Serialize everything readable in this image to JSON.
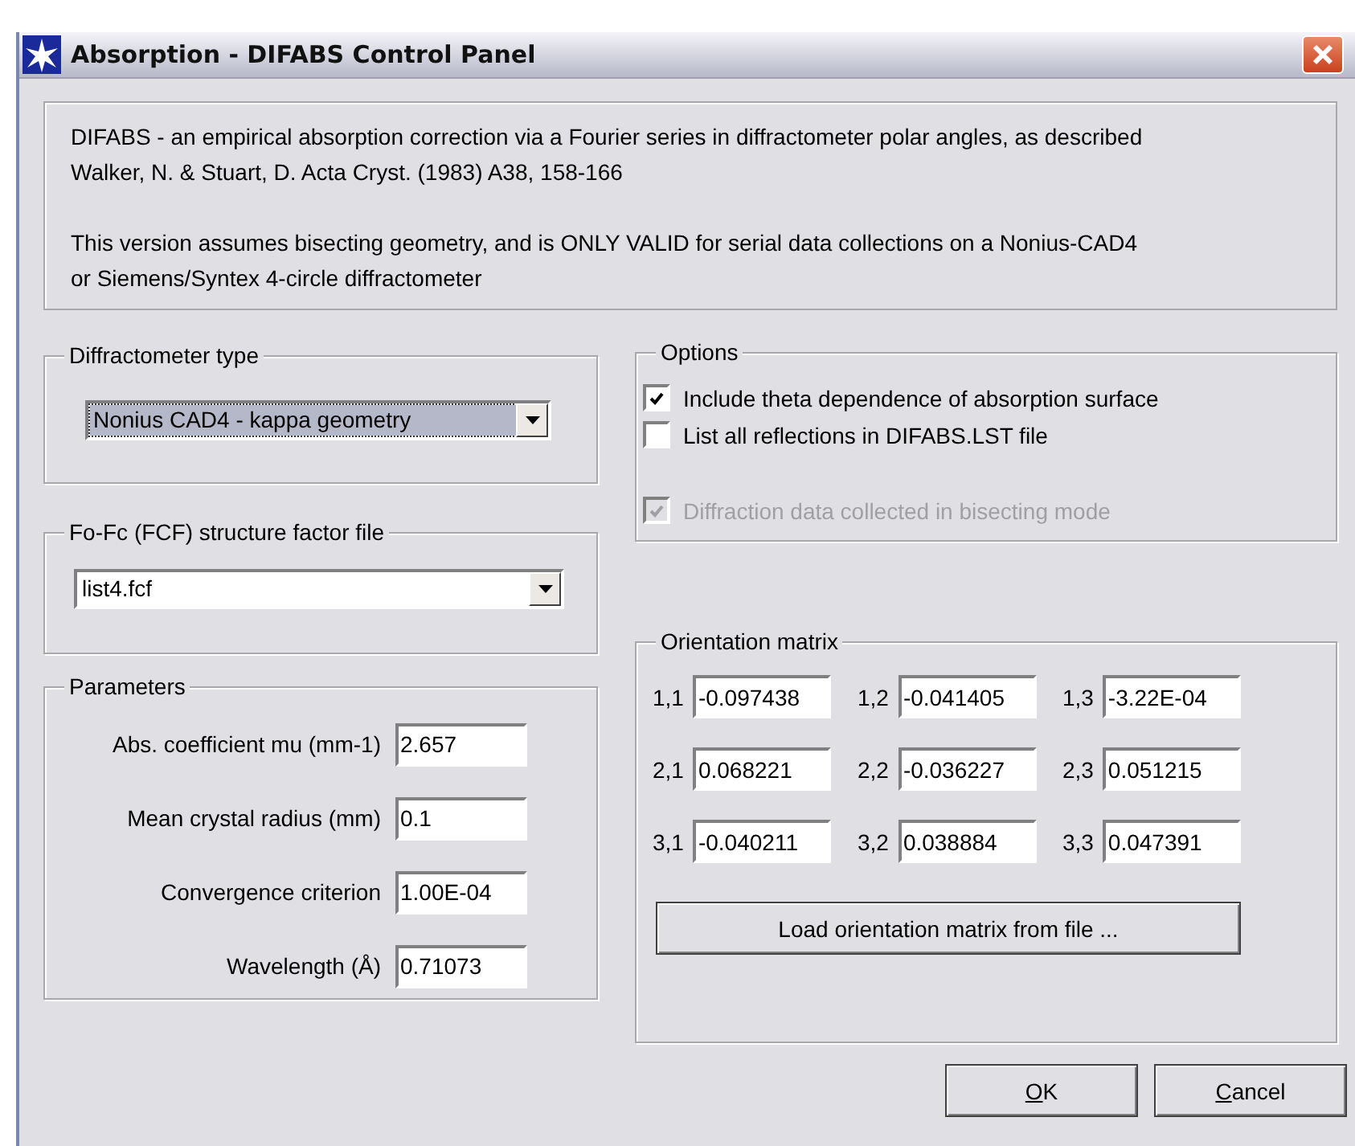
{
  "window": {
    "title": "Absorption - DIFABS Control Panel"
  },
  "description": {
    "paragraphs": [
      [
        "DIFABS - an empirical absorption correction via a Fourier series in diffractometer polar angles, as described",
        "Walker, N. & Stuart, D. Acta Cryst. (1983) A38, 158-166"
      ],
      [
        "This version assumes bisecting geometry, and is ONLY VALID for serial data collections on a Nonius-CAD4",
        "or Siemens/Syntex 4-circle diffractometer"
      ]
    ]
  },
  "diffractometer_type": {
    "title": "Diffractometer type",
    "value": "Nonius CAD4 - kappa geometry",
    "focused": true
  },
  "structure_factor_file": {
    "title": "Fo-Fc (FCF) structure factor file",
    "value": "list4.fcf",
    "focused": false
  },
  "parameters": {
    "title": "Parameters",
    "fields": [
      {
        "label": "Abs. coefficient mu (mm-1)",
        "value": "2.657"
      },
      {
        "label": "Mean crystal radius (mm)",
        "value": "0.1"
      },
      {
        "label": "Convergence criterion",
        "value": "1.00E-04"
      },
      {
        "label": "Wavelength (Å)",
        "value": "0.71073"
      }
    ]
  },
  "options": {
    "title": "Options",
    "items": [
      {
        "label": "Include theta dependence of absorption surface",
        "checked": true,
        "disabled": false
      },
      {
        "label": "List all reflections in DIFABS.LST file",
        "checked": false,
        "disabled": false
      },
      {
        "label": "Diffraction data collected in bisecting mode",
        "checked": true,
        "disabled": true
      }
    ]
  },
  "orientation_matrix": {
    "title": "Orientation matrix",
    "cells": [
      {
        "label": "1,1",
        "value": "-0.097438"
      },
      {
        "label": "1,2",
        "value": "-0.041405"
      },
      {
        "label": "1,3",
        "value": "-3.22E-04"
      },
      {
        "label": "2,1",
        "value": "0.068221"
      },
      {
        "label": "2,2",
        "value": "-0.036227"
      },
      {
        "label": "2,3",
        "value": "0.051215"
      },
      {
        "label": "3,1",
        "value": "-0.040211"
      },
      {
        "label": "3,2",
        "value": "0.038884"
      },
      {
        "label": "3,3",
        "value": "0.047391"
      }
    ],
    "load_button": "Load orientation matrix from file ..."
  },
  "buttons": [
    {
      "mnemonic": "O",
      "rest": "K"
    },
    {
      "mnemonic": "C",
      "rest": "ancel"
    }
  ]
}
